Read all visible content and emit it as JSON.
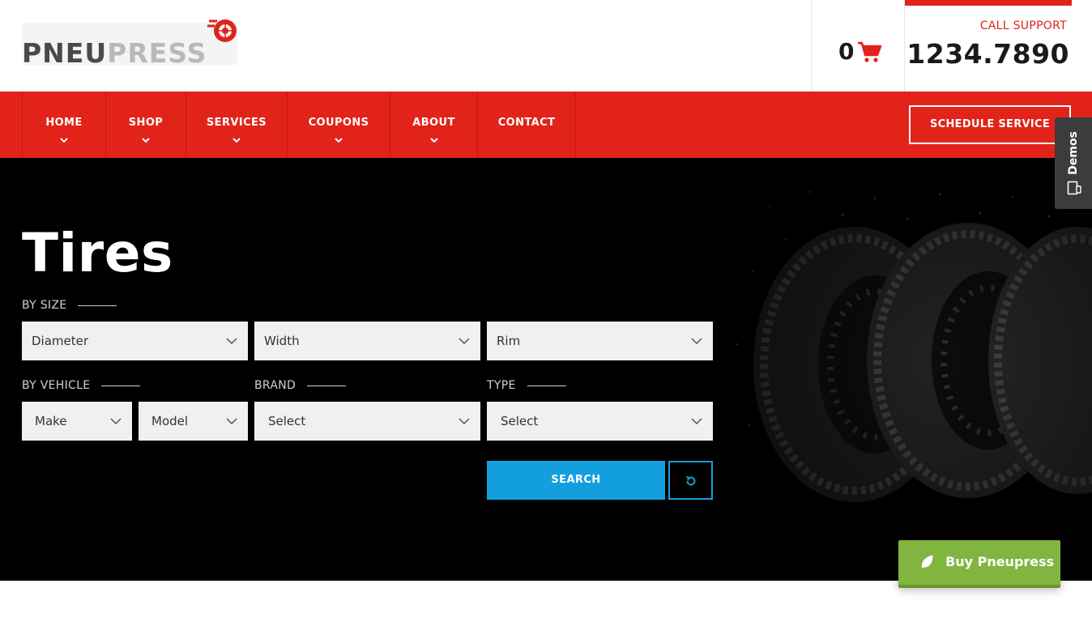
{
  "header": {
    "logo": {
      "part1": "PNEU",
      "part2": "PRESS",
      "icon": "tire-icon"
    },
    "cart": {
      "count": "0",
      "icon": "cart-icon"
    },
    "support": {
      "label": "CALL SUPPORT",
      "phone": "1234.7890"
    }
  },
  "nav": {
    "items": [
      {
        "label": "HOME",
        "has_dropdown": true
      },
      {
        "label": "SHOP",
        "has_dropdown": true
      },
      {
        "label": "SERVICES",
        "has_dropdown": true
      },
      {
        "label": "COUPONS",
        "has_dropdown": true
      },
      {
        "label": "ABOUT",
        "has_dropdown": true
      },
      {
        "label": "CONTACT",
        "has_dropdown": false
      }
    ],
    "cta": "SCHEDULE SERVICE"
  },
  "demos_tab": {
    "label": "Demos",
    "icon": "devices-icon"
  },
  "hero": {
    "title": "Tires",
    "by_size": {
      "label": "BY SIZE",
      "diameter": "Diameter",
      "width": "Width",
      "rim": "Rim"
    },
    "by_vehicle": {
      "label": "BY VEHICLE",
      "make": "Make",
      "model": "Model"
    },
    "brand": {
      "label": "BRAND",
      "value": "Select"
    },
    "type": {
      "label": "TYPE",
      "value": "Select"
    },
    "search_button": "SEARCH",
    "reset_icon": "reset-icon"
  },
  "buy_button": {
    "label": "Buy Pneupress",
    "icon": "leaf-icon"
  },
  "colors": {
    "brand_red": "#e2231a",
    "search_blue": "#139fde",
    "buy_green": "#82b440"
  }
}
